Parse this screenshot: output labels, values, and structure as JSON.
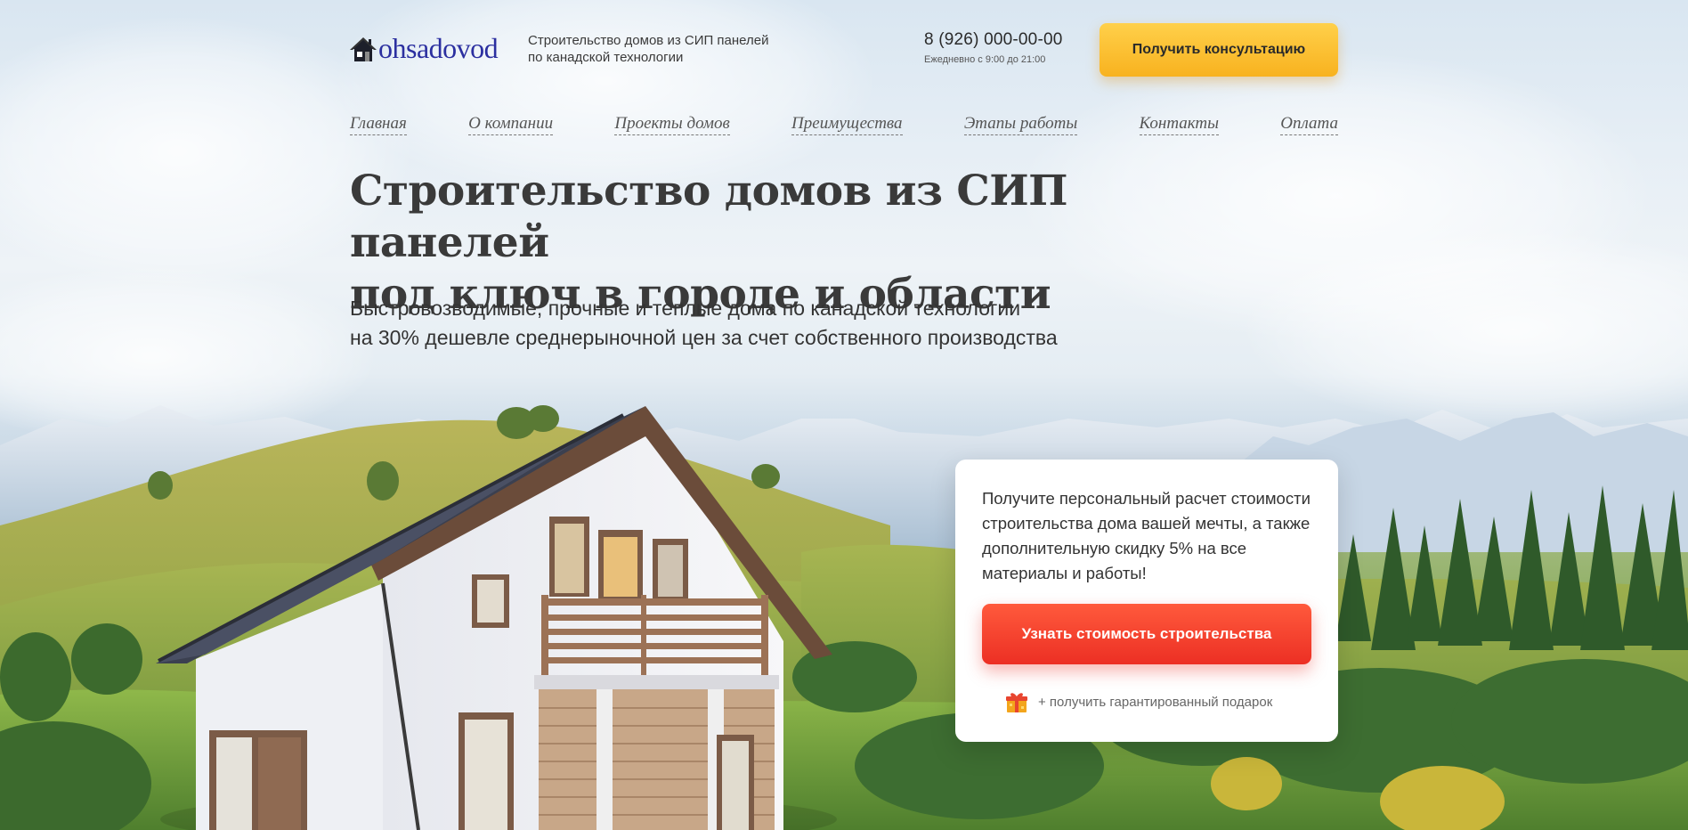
{
  "header": {
    "logo_text": "ohsadovod",
    "tagline_line1": "Строительство домов из СИП панелей",
    "tagline_line2": "по канадской технологии",
    "phone": "8 (926) 000-00-00",
    "hours": "Ежедневно с 9:00 до 21:00",
    "consult_button": "Получить консультацию"
  },
  "nav": {
    "items": [
      {
        "label": "Главная"
      },
      {
        "label": "О компании"
      },
      {
        "label": "Проекты домов"
      },
      {
        "label": "Преимущества"
      },
      {
        "label": "Этапы работы"
      },
      {
        "label": "Контакты"
      },
      {
        "label": "Оплата"
      }
    ]
  },
  "hero": {
    "title_line1": "Строительство домов из СИП панелей",
    "title_line2": "под ключ в городе и области",
    "subtitle_line1": "Быстровозводимые, прочные и теплые дома по канадской технологии",
    "subtitle_line2": "на 30% дешевле среднерыночной цен за счет собственного производства"
  },
  "offer": {
    "text": "Получите персональный расчет стоимости строительства дома вашей мечты, а также дополнительную скидку 5% на все материалы и работы!",
    "button": "Узнать стоимость строительства",
    "gift_text": "+ получить гарантированный подарок",
    "gift_icon": "gift-icon"
  },
  "colors": {
    "consult_button": "#f8b21f",
    "cost_button": "#ec2f24",
    "logo": "#2b2fa0"
  }
}
